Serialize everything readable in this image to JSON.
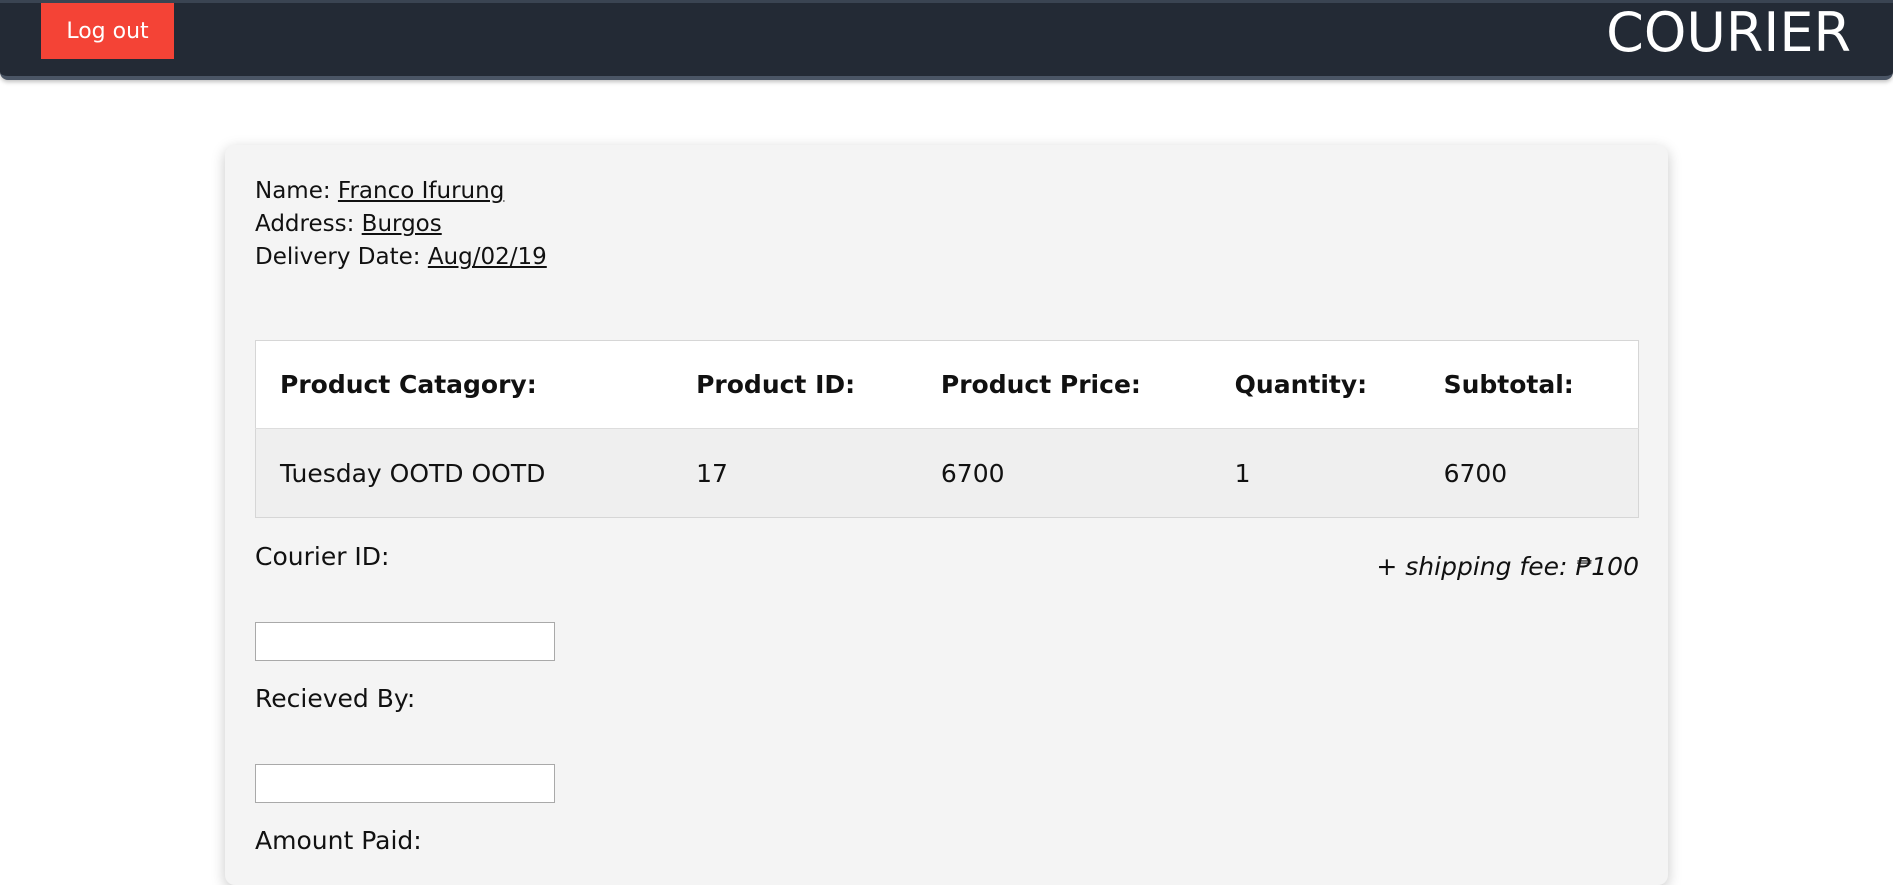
{
  "header": {
    "logout_label": "Log out",
    "brand": "COURIER"
  },
  "customer": {
    "name_label": "Name:",
    "name_value": "Franco Ifurung",
    "address_label": "Address:",
    "address_value": "Burgos",
    "delivery_label": "Delivery Date:",
    "delivery_value": "Aug/02/19"
  },
  "table": {
    "headers": [
      "Product Catagory:",
      "Product ID:",
      "Product Price:",
      "Quantity:",
      "Subtotal:"
    ],
    "rows": [
      [
        "Tuesday OOTD OOTD",
        "17",
        "6700",
        "1",
        "6700"
      ]
    ]
  },
  "form": {
    "courier_id_label": "Courier ID:",
    "courier_id_value": "",
    "received_by_label": "Recieved By:",
    "received_by_value": "",
    "amount_paid_label": "Amount Paid:"
  },
  "shipping_note": "+ shipping fee: ₱100",
  "colors": {
    "navbar": "#232a35",
    "logout": "#f44336",
    "card": "#f4f4f4"
  }
}
